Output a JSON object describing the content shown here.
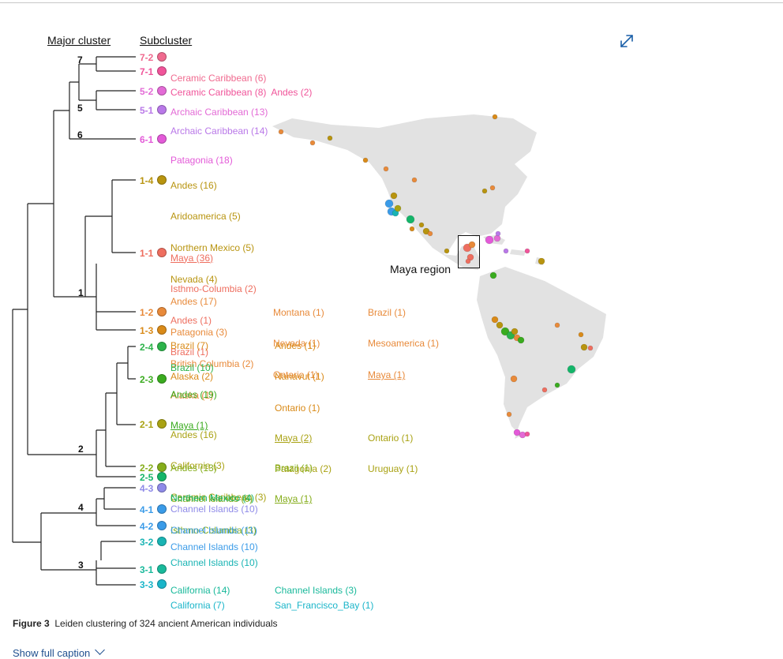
{
  "headers": {
    "major": "Major cluster",
    "sub": "Subcluster"
  },
  "cluster_labels": {
    "c7": "7",
    "c5": "5",
    "c6": "6",
    "c1": "1",
    "c2": "2",
    "c4": "4",
    "c3": "3"
  },
  "colors": {
    "c7_2": "#f06a8f",
    "c7_1": "#f0549a",
    "c5_2": "#e36bd6",
    "c5_1": "#b978e8",
    "c6_1": "#e35ad8",
    "c1_4": "#b8940f",
    "c1_1": "#ee6e5f",
    "c1_2": "#e88a3a",
    "c1_3": "#d98a18",
    "c2_4": "#2cb34a",
    "c2_3": "#3aab1f",
    "c2_1": "#a9a213",
    "c2_2": "#85ad1a",
    "c2_5": "#14b569",
    "c4_3": "#8e8ae8",
    "c4_1": "#3a9be8",
    "c4_2": "#3a9be8",
    "c3_2": "#19b4b4",
    "c3_1": "#19b99b",
    "c3_3": "#1ab5c9"
  },
  "subclusters": {
    "s7_2": {
      "id": "7-2",
      "col1": [
        "Ceramic Caribbean (6)"
      ]
    },
    "s7_1": {
      "id": "7-1",
      "col1": [
        "Ceramic Caribbean (8)  Andes (2)"
      ]
    },
    "s5_2": {
      "id": "5-2",
      "col1": [
        "Archaic Caribbean (13)"
      ]
    },
    "s5_1": {
      "id": "5-1",
      "col1": [
        "Archaic Caribbean (14)"
      ]
    },
    "s6_1": {
      "id": "6-1",
      "col1": [
        "Patagonia (18)"
      ]
    },
    "s1_4": {
      "id": "1-4",
      "col1": [
        "Andes (16)",
        "Aridoamerica (5)",
        "Northern Mexico (5)",
        "Nevada (4)"
      ]
    },
    "s1_1": {
      "id": "1-1",
      "col1": [
        "Maya (36)",
        "Isthmo-Columbia (2)",
        "Andes (1)",
        "Brazil (1)"
      ]
    },
    "s1_2": {
      "id": "1-2",
      "col1": [
        "Andes (17)",
        "Patagonia (3)",
        "British Columbia (2)",
        "Alaska (1)"
      ],
      "col2": [
        "Montana (1)",
        "Nevada (1)",
        "Ontario (1)"
      ],
      "col3": [
        "Brazil (1)",
        "Mesoamerica (1)",
        "Maya (1)"
      ]
    },
    "s1_3": {
      "id": "1-3",
      "col1": [
        "Brazil (7)",
        "Alaska (2)"
      ],
      "col2": [
        "Andes (1)",
        "Nanavut (1)",
        "Ontario (1)"
      ]
    },
    "s2_4": {
      "id": "2-4",
      "col1": [
        "Brazil (10)"
      ]
    },
    "s2_3": {
      "id": "2-3",
      "col1": [
        "Andes (19)",
        "Maya (1)"
      ]
    },
    "s2_1": {
      "id": "2-1",
      "col1": [
        "Andes (16)",
        "California (3)",
        "Ceramic Caribbean (3)"
      ],
      "col2": [
        "Maya (2)",
        "Patagonia (2)"
      ],
      "col3": [
        "Ontario (1)",
        "Uruguay (1)"
      ]
    },
    "s2_2": {
      "id": "2-2",
      "col1": [
        "Andes (13)",
        "Channel Islands (6)",
        "Isthmo-Columbia (3)"
      ],
      "col2": [
        "Brazil (1)",
        "Maya (1)"
      ]
    },
    "s2_5": {
      "id": "2-5",
      "col1": [
        "Northern Mexico (4)"
      ]
    },
    "s4_3": {
      "id": "4-3",
      "col1": [
        "Channel Islands (10)"
      ]
    },
    "s4_1": {
      "id": "4-1",
      "col1": [
        "Channel Islands (11)"
      ]
    },
    "s4_2": {
      "id": "4-2",
      "col1": [
        "Channel Islands (10)"
      ]
    },
    "s3_2": {
      "id": "3-2",
      "col1": [
        "Channel Islands (10)"
      ]
    },
    "s3_1": {
      "id": "3-1",
      "col1": [
        "California (14)"
      ],
      "col2": [
        "Channel Islands (3)"
      ]
    },
    "s3_3": {
      "id": "3-3",
      "col1": [
        "California (7)"
      ],
      "col2": [
        "San_Francisco_Bay (1)"
      ]
    }
  },
  "map": {
    "maya_label": "Maya region"
  },
  "caption": {
    "figure_label": "Figure 3",
    "text": "Leiden clustering of 324 ancient American individuals"
  },
  "show_caption": {
    "label": "Show full caption"
  },
  "icons": {
    "expand": "expand-icon",
    "chevron": "chevron-down-icon"
  }
}
